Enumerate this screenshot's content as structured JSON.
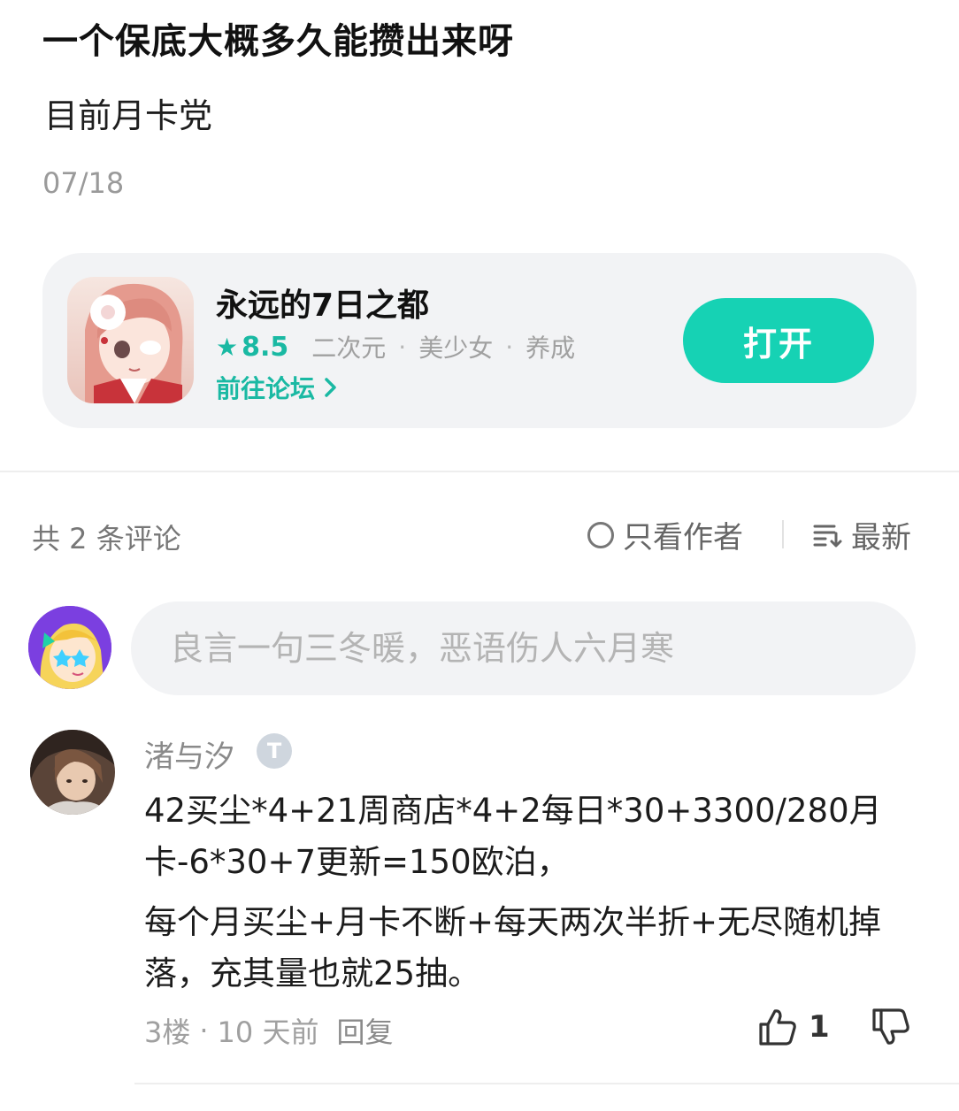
{
  "post": {
    "title": "一个保底大概多久能攒出来呀",
    "body": "目前月卡党",
    "date": "07/18"
  },
  "game_card": {
    "name": "永远的7日之都",
    "rating": "8.5",
    "tags": [
      "二次元",
      "美少女",
      "养成"
    ],
    "tag_separator": "·",
    "forum_link": "前往论坛",
    "open_button": "打开",
    "accent_color": "#16d2b4"
  },
  "comments_header": {
    "count_text": "共 2 条评论",
    "author_only": "只看作者",
    "sort": "最新"
  },
  "comment_box": {
    "placeholder": "良言一句三冬暖，恶语伤人六月寒"
  },
  "comments": [
    {
      "username": "渚与汐",
      "badge": "T",
      "lines": [
        "42买尘*4+21周商店*4+2每日*30+3300/280月卡-6*30+7更新=150欧泊，",
        "每个月买尘+月卡不断+每天两次半折+无尽随机掉落，充其量也就25抽。"
      ],
      "floor": "3楼",
      "time": "10 天前",
      "meta_separator": "·",
      "reply": "回复",
      "likes": "1"
    }
  ]
}
